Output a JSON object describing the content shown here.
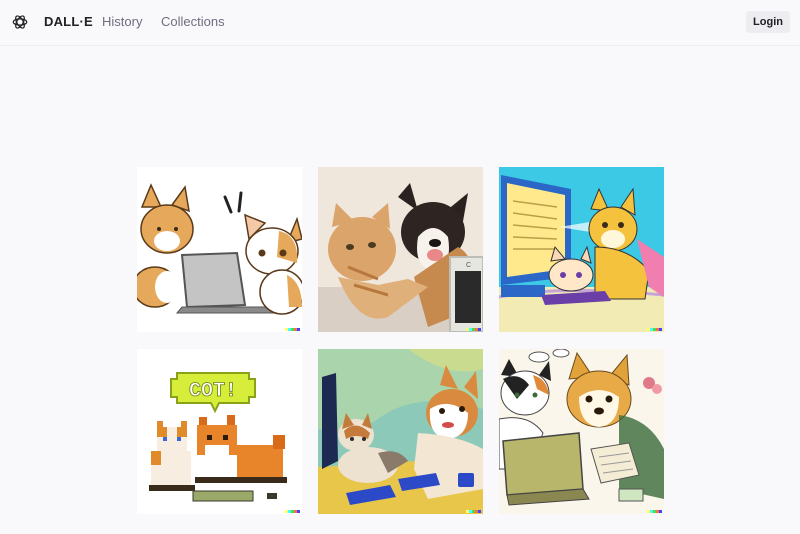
{
  "header": {
    "brand": "DALL·E",
    "nav": [
      {
        "label": "History"
      },
      {
        "label": "Collections"
      }
    ],
    "login_label": "Login"
  },
  "gallery": {
    "tiles": [
      {
        "icon": "cartoon-corgi-cat-laptop-image"
      },
      {
        "icon": "photo-cat-corgi-computer-image"
      },
      {
        "icon": "anime-corgi-cat-monitor-image"
      },
      {
        "icon": "pixel-art-cat-corgi-image",
        "speech_text": "COT!"
      },
      {
        "icon": "painting-cat-corgi-keyboard-image"
      },
      {
        "icon": "watercolor-corgi-cat-laptop-image"
      }
    ]
  },
  "colors": {
    "background": "#f9f9fb",
    "login_bg": "#ececf1",
    "watermark": [
      "#ffff66",
      "#42ffff",
      "#51da4c",
      "#ff6e3c",
      "#3c46ff"
    ]
  }
}
